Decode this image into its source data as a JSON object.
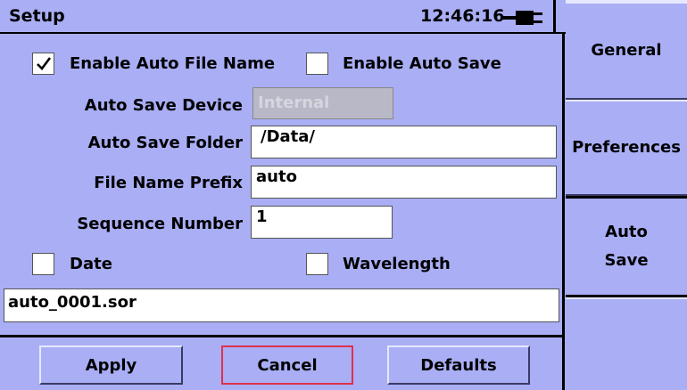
{
  "title": "Setup",
  "clock": "12:46:16",
  "icons": {
    "battery": "battery-plug-icon",
    "check": "checkmark-icon"
  },
  "colors": {
    "panel_bg": "#a9aef5",
    "focus_border": "#e0304a"
  },
  "options": {
    "enable_auto_file_name": {
      "label": "Enable Auto File Name",
      "checked": true
    },
    "enable_auto_save": {
      "label": "Enable Auto Save",
      "checked": false
    },
    "date": {
      "label": "Date",
      "checked": false
    },
    "wavelength": {
      "label": "Wavelength",
      "checked": false
    }
  },
  "fields": {
    "auto_save_device": {
      "label": "Auto Save Device",
      "value": "Internal",
      "disabled": true
    },
    "auto_save_folder": {
      "label": "Auto Save Folder",
      "value": "/Data/"
    },
    "file_name_prefix": {
      "label": "File Name Prefix",
      "value": "auto"
    },
    "sequence_number": {
      "label": "Sequence Number",
      "value": "1"
    }
  },
  "preview": "auto_0001.sor",
  "buttons": {
    "apply": "Apply",
    "cancel": "Cancel",
    "defaults": "Defaults"
  },
  "tabs": [
    {
      "label": "General",
      "active": false
    },
    {
      "label": "Preferences",
      "active": false
    },
    {
      "label": "Auto Save",
      "active": true
    },
    {
      "label": "",
      "active": false
    }
  ]
}
